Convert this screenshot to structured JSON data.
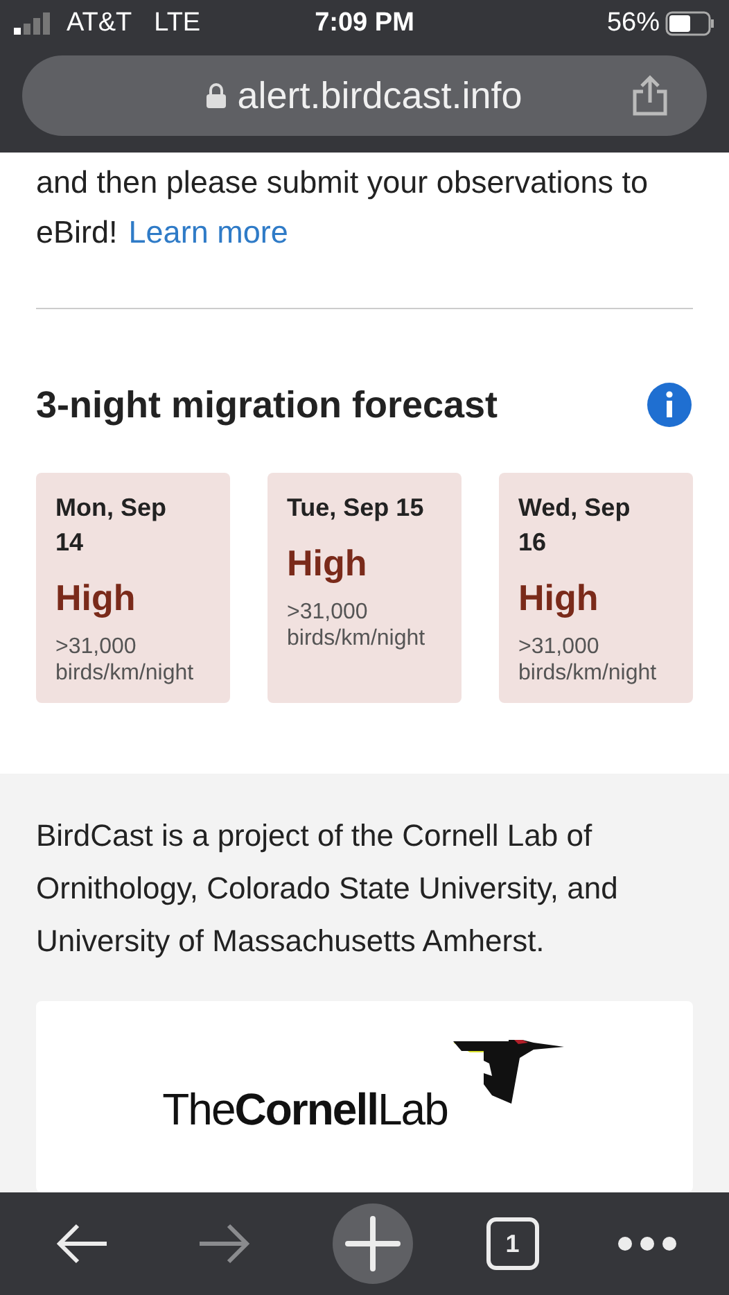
{
  "status_bar": {
    "carrier": "AT&T",
    "network": "LTE",
    "time": "7:09 PM",
    "battery": "56%"
  },
  "address_bar": {
    "url": "alert.birdcast.info"
  },
  "intro": {
    "text": "and then please submit your observations to eBird!",
    "link": "Learn more"
  },
  "forecast": {
    "title": "3-night migration forecast",
    "days": [
      {
        "date": "Mon, Sep 14",
        "level": "High",
        "amount": ">31,000 birds/km/night"
      },
      {
        "date": "Tue, Sep 15",
        "level": "High",
        "amount": ">31,000 birds/km/night"
      },
      {
        "date": "Wed, Sep 16",
        "level": "High",
        "amount": ">31,000 birds/km/night"
      }
    ]
  },
  "footer": {
    "text": "BirdCast is a project of the Cornell Lab of Ornithology, Colorado State University, and University of Massachusetts Amherst.",
    "logo": "The**Cornell**Lab"
  },
  "toolbar": [
    {
      "kind": "back",
      "disabled": false
    },
    {
      "kind": "forward",
      "disabled": true
    },
    {
      "kind": "new-tab",
      "disabled": false
    },
    {
      "kind": "tabs",
      "count": "1",
      "disabled": false
    },
    {
      "kind": "menu",
      "disabled": false
    }
  ]
}
